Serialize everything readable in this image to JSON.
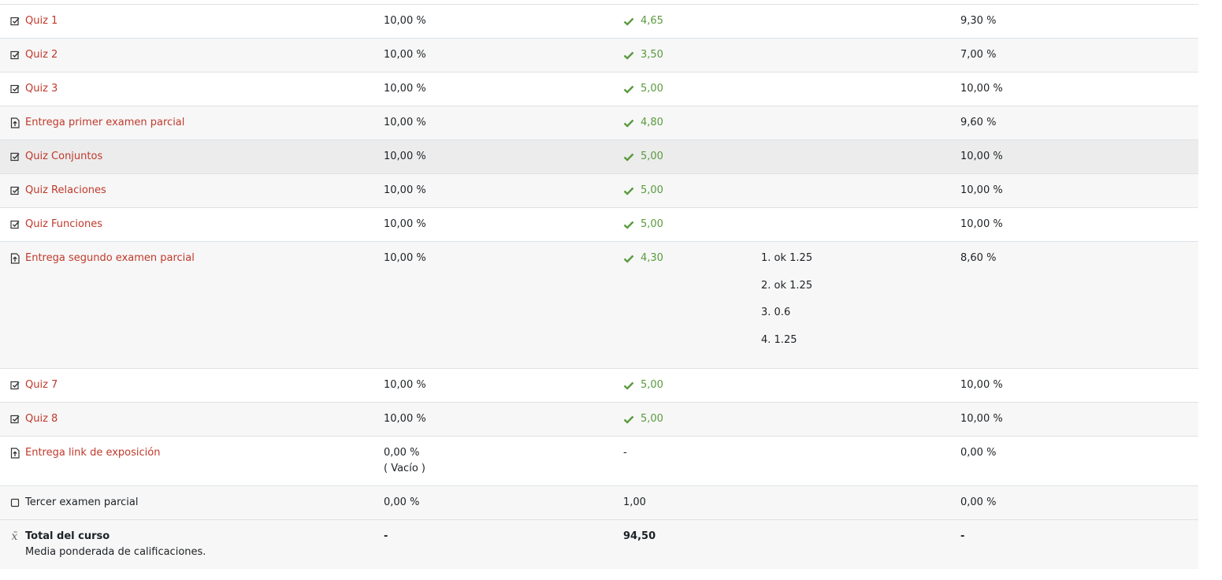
{
  "rows": [
    {
      "name": "Quiz 1",
      "weight": "10,00 %",
      "grade": "4,65",
      "contribution": "9,30 %"
    },
    {
      "name": "Quiz 2",
      "weight": "10,00 %",
      "grade": "3,50",
      "contribution": "7,00 %"
    },
    {
      "name": "Quiz 3",
      "weight": "10,00 %",
      "grade": "5,00",
      "contribution": "10,00 %"
    },
    {
      "name": "Entrega primer examen parcial",
      "weight": "10,00 %",
      "grade": "4,80",
      "contribution": "9,60 %"
    },
    {
      "name": "Quiz Conjuntos",
      "weight": "10,00 %",
      "grade": "5,00",
      "contribution": "10,00 %"
    },
    {
      "name": "Quiz Relaciones",
      "weight": "10,00 %",
      "grade": "5,00",
      "contribution": "10,00 %"
    },
    {
      "name": "Quiz Funciones",
      "weight": "10,00 %",
      "grade": "5,00",
      "contribution": "10,00 %"
    },
    {
      "name": "Entrega segundo examen parcial",
      "weight": "10,00 %",
      "grade": "4,30",
      "feedback": [
        "1. ok 1.25",
        "2. ok 1.25",
        "3. 0.6",
        "4. 1.25"
      ],
      "contribution": "8,60 %"
    },
    {
      "name": "Quiz 7",
      "weight": "10,00 %",
      "grade": "5,00",
      "contribution": "10,00 %"
    },
    {
      "name": "Quiz 8",
      "weight": "10,00 %",
      "grade": "5,00",
      "contribution": "10,00 %"
    },
    {
      "name": "Entrega link de exposición",
      "weight": "0,00 %",
      "weight_note": "( Vacío )",
      "grade": "-",
      "contribution": "0,00 %"
    },
    {
      "name": "Tercer examen parcial",
      "weight": "0,00 %",
      "grade": "1,00",
      "contribution": "0,00 %"
    }
  ],
  "total": {
    "name": "Total del curso",
    "description": "Media ponderada de calificaciones.",
    "weight": "-",
    "grade": "94,50",
    "contribution": "-"
  },
  "colors": {
    "link": "#c0392b",
    "ok": "#5a9a3e"
  },
  "icons": {
    "quiz": "quiz-check-icon",
    "assignment": "assignment-upload-icon",
    "manual": "manual-item-icon",
    "total": "x-bar-icon",
    "passed": "checkmark-icon"
  }
}
